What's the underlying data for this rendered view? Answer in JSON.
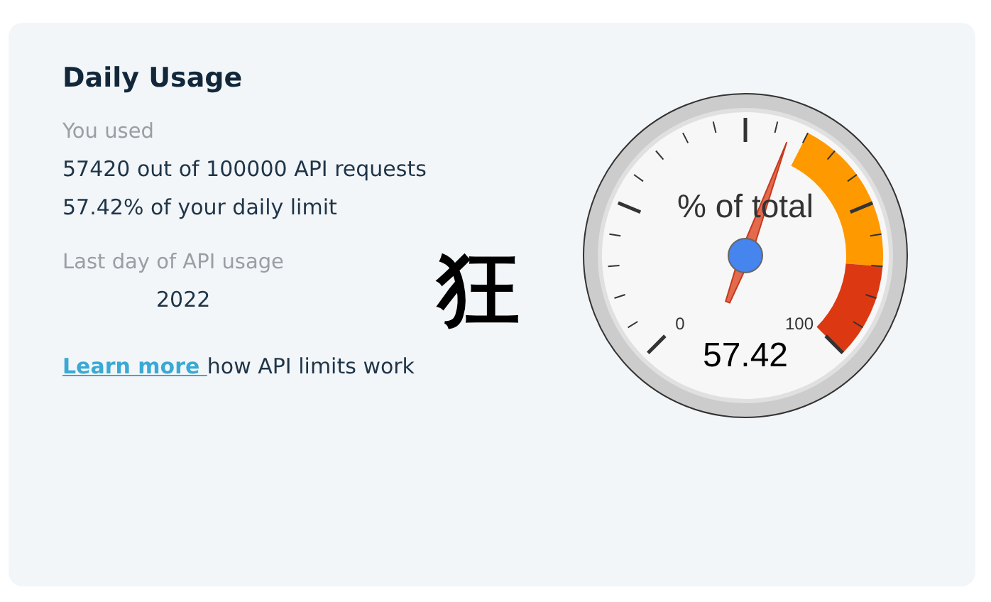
{
  "card": {
    "title": "Daily Usage",
    "used_label": "You used",
    "used_lines": [
      "57420 out of 100000 API requests",
      "57.42% of your daily limit"
    ],
    "last_day_label": "Last day of API usage",
    "last_day_value": "2022",
    "link": {
      "text": "Learn more ",
      "after": "how API limits work"
    },
    "stamp": "狂",
    "gauge": {
      "label": "% of total",
      "min_label": "0",
      "max_label": "100",
      "value": "57.42",
      "level": 0.5742
    }
  }
}
